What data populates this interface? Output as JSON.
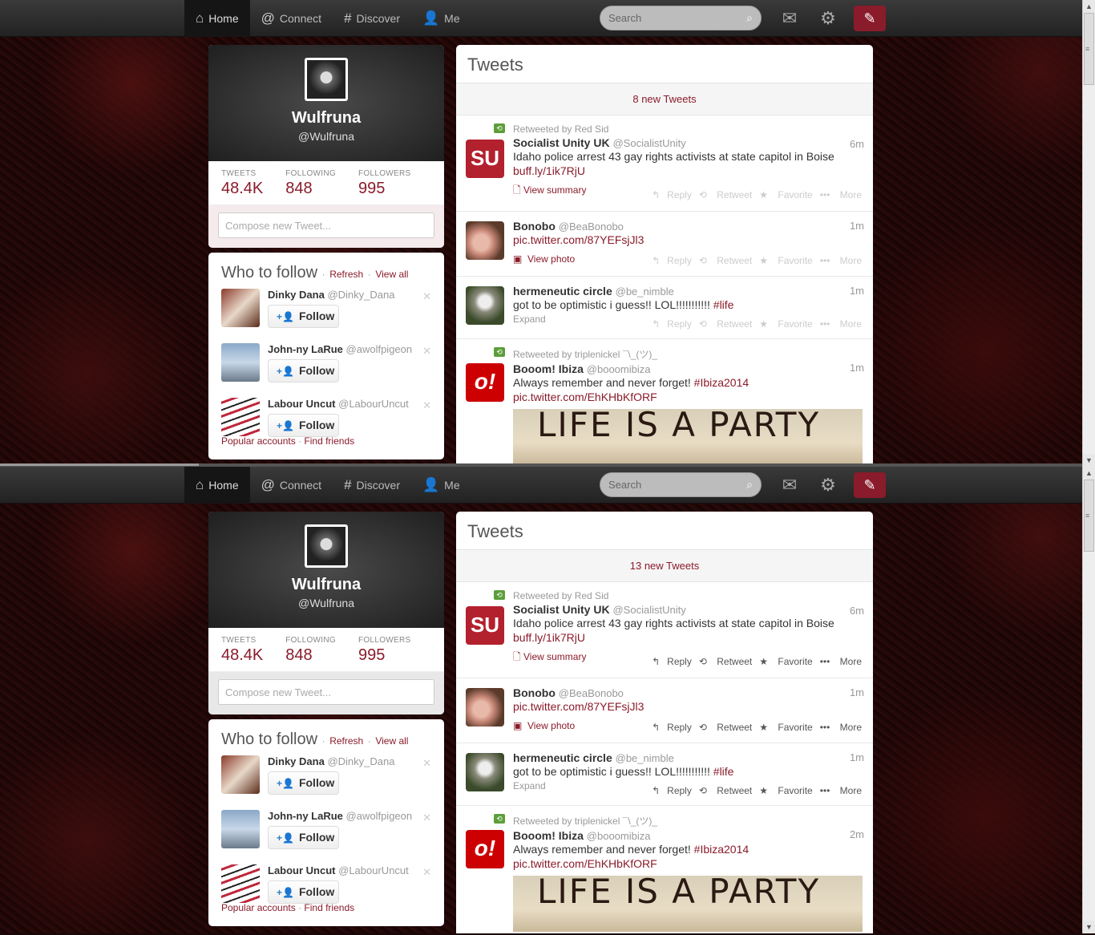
{
  "nav": {
    "home": "Home",
    "connect": "Connect",
    "discover": "Discover",
    "me": "Me",
    "search_placeholder": "Search"
  },
  "profile": {
    "name": "Wulfruna",
    "handle": "@Wulfruna",
    "tweets_label": "TWEETS",
    "tweets": "48.4K",
    "following_label": "FOLLOWING",
    "following": "848",
    "followers_label": "FOLLOWERS",
    "followers": "995",
    "compose_placeholder": "Compose new Tweet..."
  },
  "wtf": {
    "title": "Who to follow",
    "refresh": "Refresh",
    "view_all": "View all",
    "follow_label": "Follow",
    "popular": "Popular accounts",
    "find_friends": "Find friends",
    "items": [
      {
        "name": "Dinky Dana",
        "handle": "@Dinky_Dana"
      },
      {
        "name": "John-ny LaRue",
        "handle": "@awolfpigeon"
      },
      {
        "name": "Labour Uncut",
        "handle": "@LabourUncut"
      }
    ]
  },
  "timeline": {
    "title": "Tweets",
    "new_tweets_top": "8 new Tweets",
    "new_tweets_bottom": "13 new Tweets",
    "reply": "Reply",
    "retweet": "Retweet",
    "favorite": "Favorite",
    "more": "More",
    "tweets": [
      {
        "retweeted_by": "Retweeted by Red Sid",
        "name": "Socialist Unity UK",
        "handle": "@SocialistUnity",
        "time": "6m",
        "text": "Idaho police arrest 43 gay rights activists at state capitol in Boise",
        "link": "buff.ly/1ik7RjU",
        "meta": "View summary"
      },
      {
        "name": "Bonobo",
        "handle": "@BeaBonobo",
        "time": "1m",
        "link": "pic.twitter.com/87YEFsjJl3",
        "meta": "View photo"
      },
      {
        "name": "hermeneutic circle",
        "handle": "@be_nimble",
        "time": "1m",
        "text": "got to be optimistic i guess!! LOL!!!!!!!!!!!",
        "hashtag": "#life",
        "meta": "Expand"
      },
      {
        "retweeted_by": "Retweeted by triplenickel ¯\\_(ツ)_",
        "name": "Booom! Ibiza",
        "handle": "@booomibiza",
        "time_top": "1m",
        "time_bottom": "2m",
        "text": "Always remember and never forget!",
        "hashtag": "#Ibiza2014",
        "link": "pic.twitter.com/EhKHbKfORF",
        "image_text": "LIFE IS A PARTY"
      }
    ]
  },
  "colors": {
    "accent": "#8a1b2a",
    "background": "#1c0606"
  }
}
